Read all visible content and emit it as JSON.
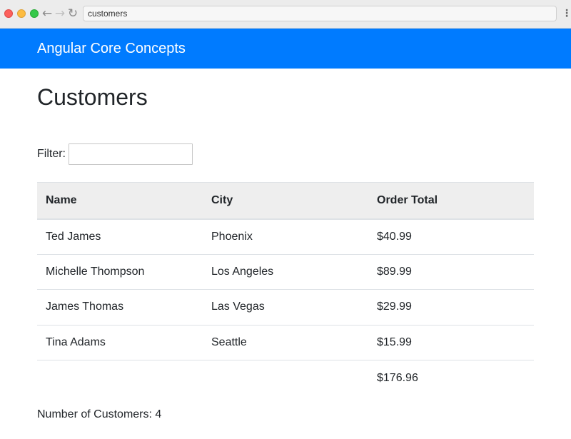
{
  "browser": {
    "url": "customers",
    "back_icon": "←",
    "forward_icon": "→",
    "reload_icon": "↻",
    "menu_icon": "⋮"
  },
  "header": {
    "brand": "Angular Core Concepts",
    "color": "#007bff"
  },
  "page": {
    "title": "Customers",
    "filter_label": "Filter:",
    "filter_value": "",
    "filter_placeholder": ""
  },
  "table": {
    "headers": [
      "Name",
      "City",
      "Order Total"
    ],
    "rows": [
      [
        "Ted James",
        "Phoenix",
        "$40.99"
      ],
      [
        "Michelle Thompson",
        "Los Angeles",
        "$89.99"
      ],
      [
        "James Thomas",
        "Las Vegas",
        "$29.99"
      ],
      [
        "Tina Adams",
        "Seattle",
        "$15.99"
      ]
    ],
    "total": "$176.96"
  },
  "footer": {
    "count_text": "Number of Customers: 4"
  }
}
